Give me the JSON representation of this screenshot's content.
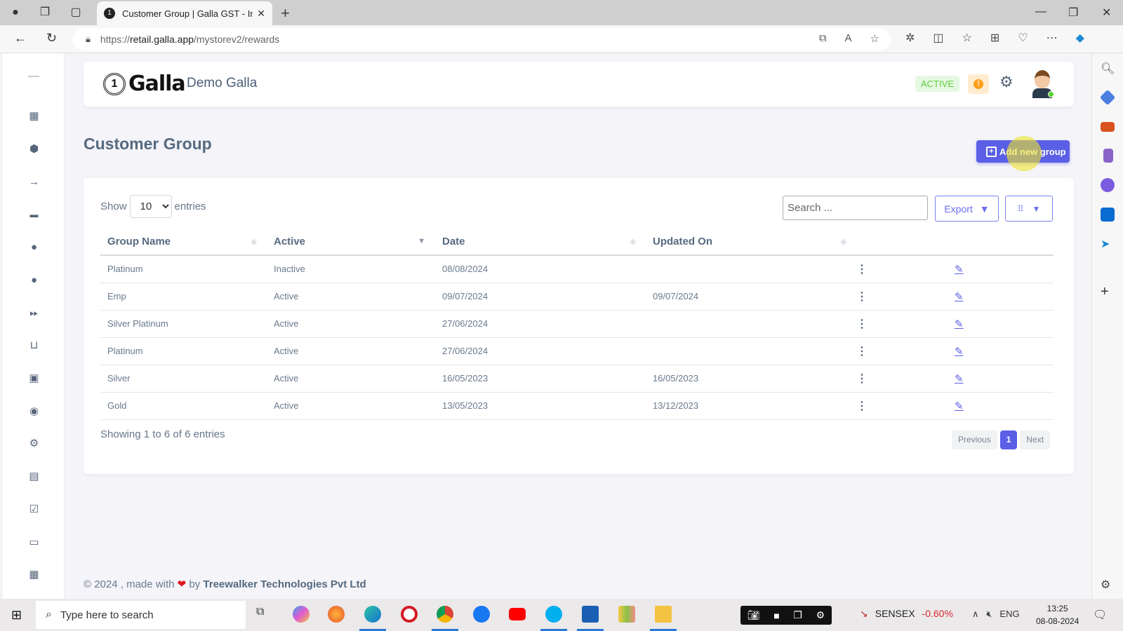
{
  "browser": {
    "tab_title": "Customer Group | Galla GST - Inv",
    "tab_favicon": "galla-coin-icon",
    "url_prefix": "https://",
    "url_domain": "retail.galla.app",
    "url_path": "/mystorev2/rewards",
    "toolbar_icons": [
      "open-in-app-icon",
      "read-aloud-icon",
      "favorite-star-icon"
    ],
    "extension_icons": [
      "extensions-icon",
      "split-screen-icon",
      "favorites-icon",
      "collections-icon",
      "browser-essentials-icon",
      "more-icon"
    ]
  },
  "browser_sidebar": {
    "icons": [
      "search-icon",
      "shopping-tag-icon",
      "tools-icon",
      "games-icon",
      "microsoft-365-icon",
      "outlook-icon",
      "telegram-icon",
      "add-icon"
    ]
  },
  "left_nav": {
    "icons": [
      "collapse-icon",
      "dashboard-icon",
      "product-box-icon",
      "arrow-right-icon",
      "coupon-icon",
      "customer-icon",
      "user-icon",
      "forward-icon",
      "basket-icon",
      "contacts-icon",
      "location-icon",
      "settings-icon",
      "report-icon",
      "checklist-icon",
      "cash-icon",
      "calendar-icon"
    ]
  },
  "header": {
    "brand": "Galla",
    "logo_glyph": "1",
    "store_name": "Demo Galla",
    "status_badge": "ACTIVE",
    "alert_glyph": "!"
  },
  "page": {
    "title": "Customer Group",
    "add_button": "Add new group"
  },
  "table_controls": {
    "show_label": "Show",
    "entries_label": "entries",
    "page_size": "10",
    "search_placeholder": "Search ...",
    "export_label": "Export"
  },
  "table": {
    "columns": [
      "Group Name",
      "Active",
      "Date",
      "Updated On"
    ],
    "rows": [
      {
        "name": "Platinum",
        "active": "Inactive",
        "date": "08/08/2024",
        "updated": ""
      },
      {
        "name": "Emp",
        "active": "Active",
        "date": "09/07/2024",
        "updated": "09/07/2024"
      },
      {
        "name": "Silver Platinum",
        "active": "Active",
        "date": "27/06/2024",
        "updated": ""
      },
      {
        "name": "Platinum",
        "active": "Active",
        "date": "27/06/2024",
        "updated": ""
      },
      {
        "name": "Silver",
        "active": "Active",
        "date": "16/05/2023",
        "updated": "16/05/2023"
      },
      {
        "name": "Gold",
        "active": "Active",
        "date": "13/05/2023",
        "updated": "13/12/2023"
      }
    ]
  },
  "pagination": {
    "info": "Showing 1 to 6 of 6 entries",
    "previous": "Previous",
    "current": "1",
    "next": "Next"
  },
  "footer": {
    "prefix": "© 2024 , made with",
    "by": "by",
    "company": "Treewalker Technologies Pvt Ltd"
  },
  "taskbar": {
    "search_placeholder": "Type here to search",
    "ticker_name": "SENSEX",
    "ticker_change": "-0.60%",
    "language": "ENG",
    "time": "13:25",
    "date": "08-08-2024"
  },
  "colors": {
    "accent": "#5a5fe6",
    "active_badge_bg": "#e6f8e1",
    "active_badge_text": "#5ece3e",
    "warn": "#ff9f1a",
    "heading": "#566a7f"
  }
}
